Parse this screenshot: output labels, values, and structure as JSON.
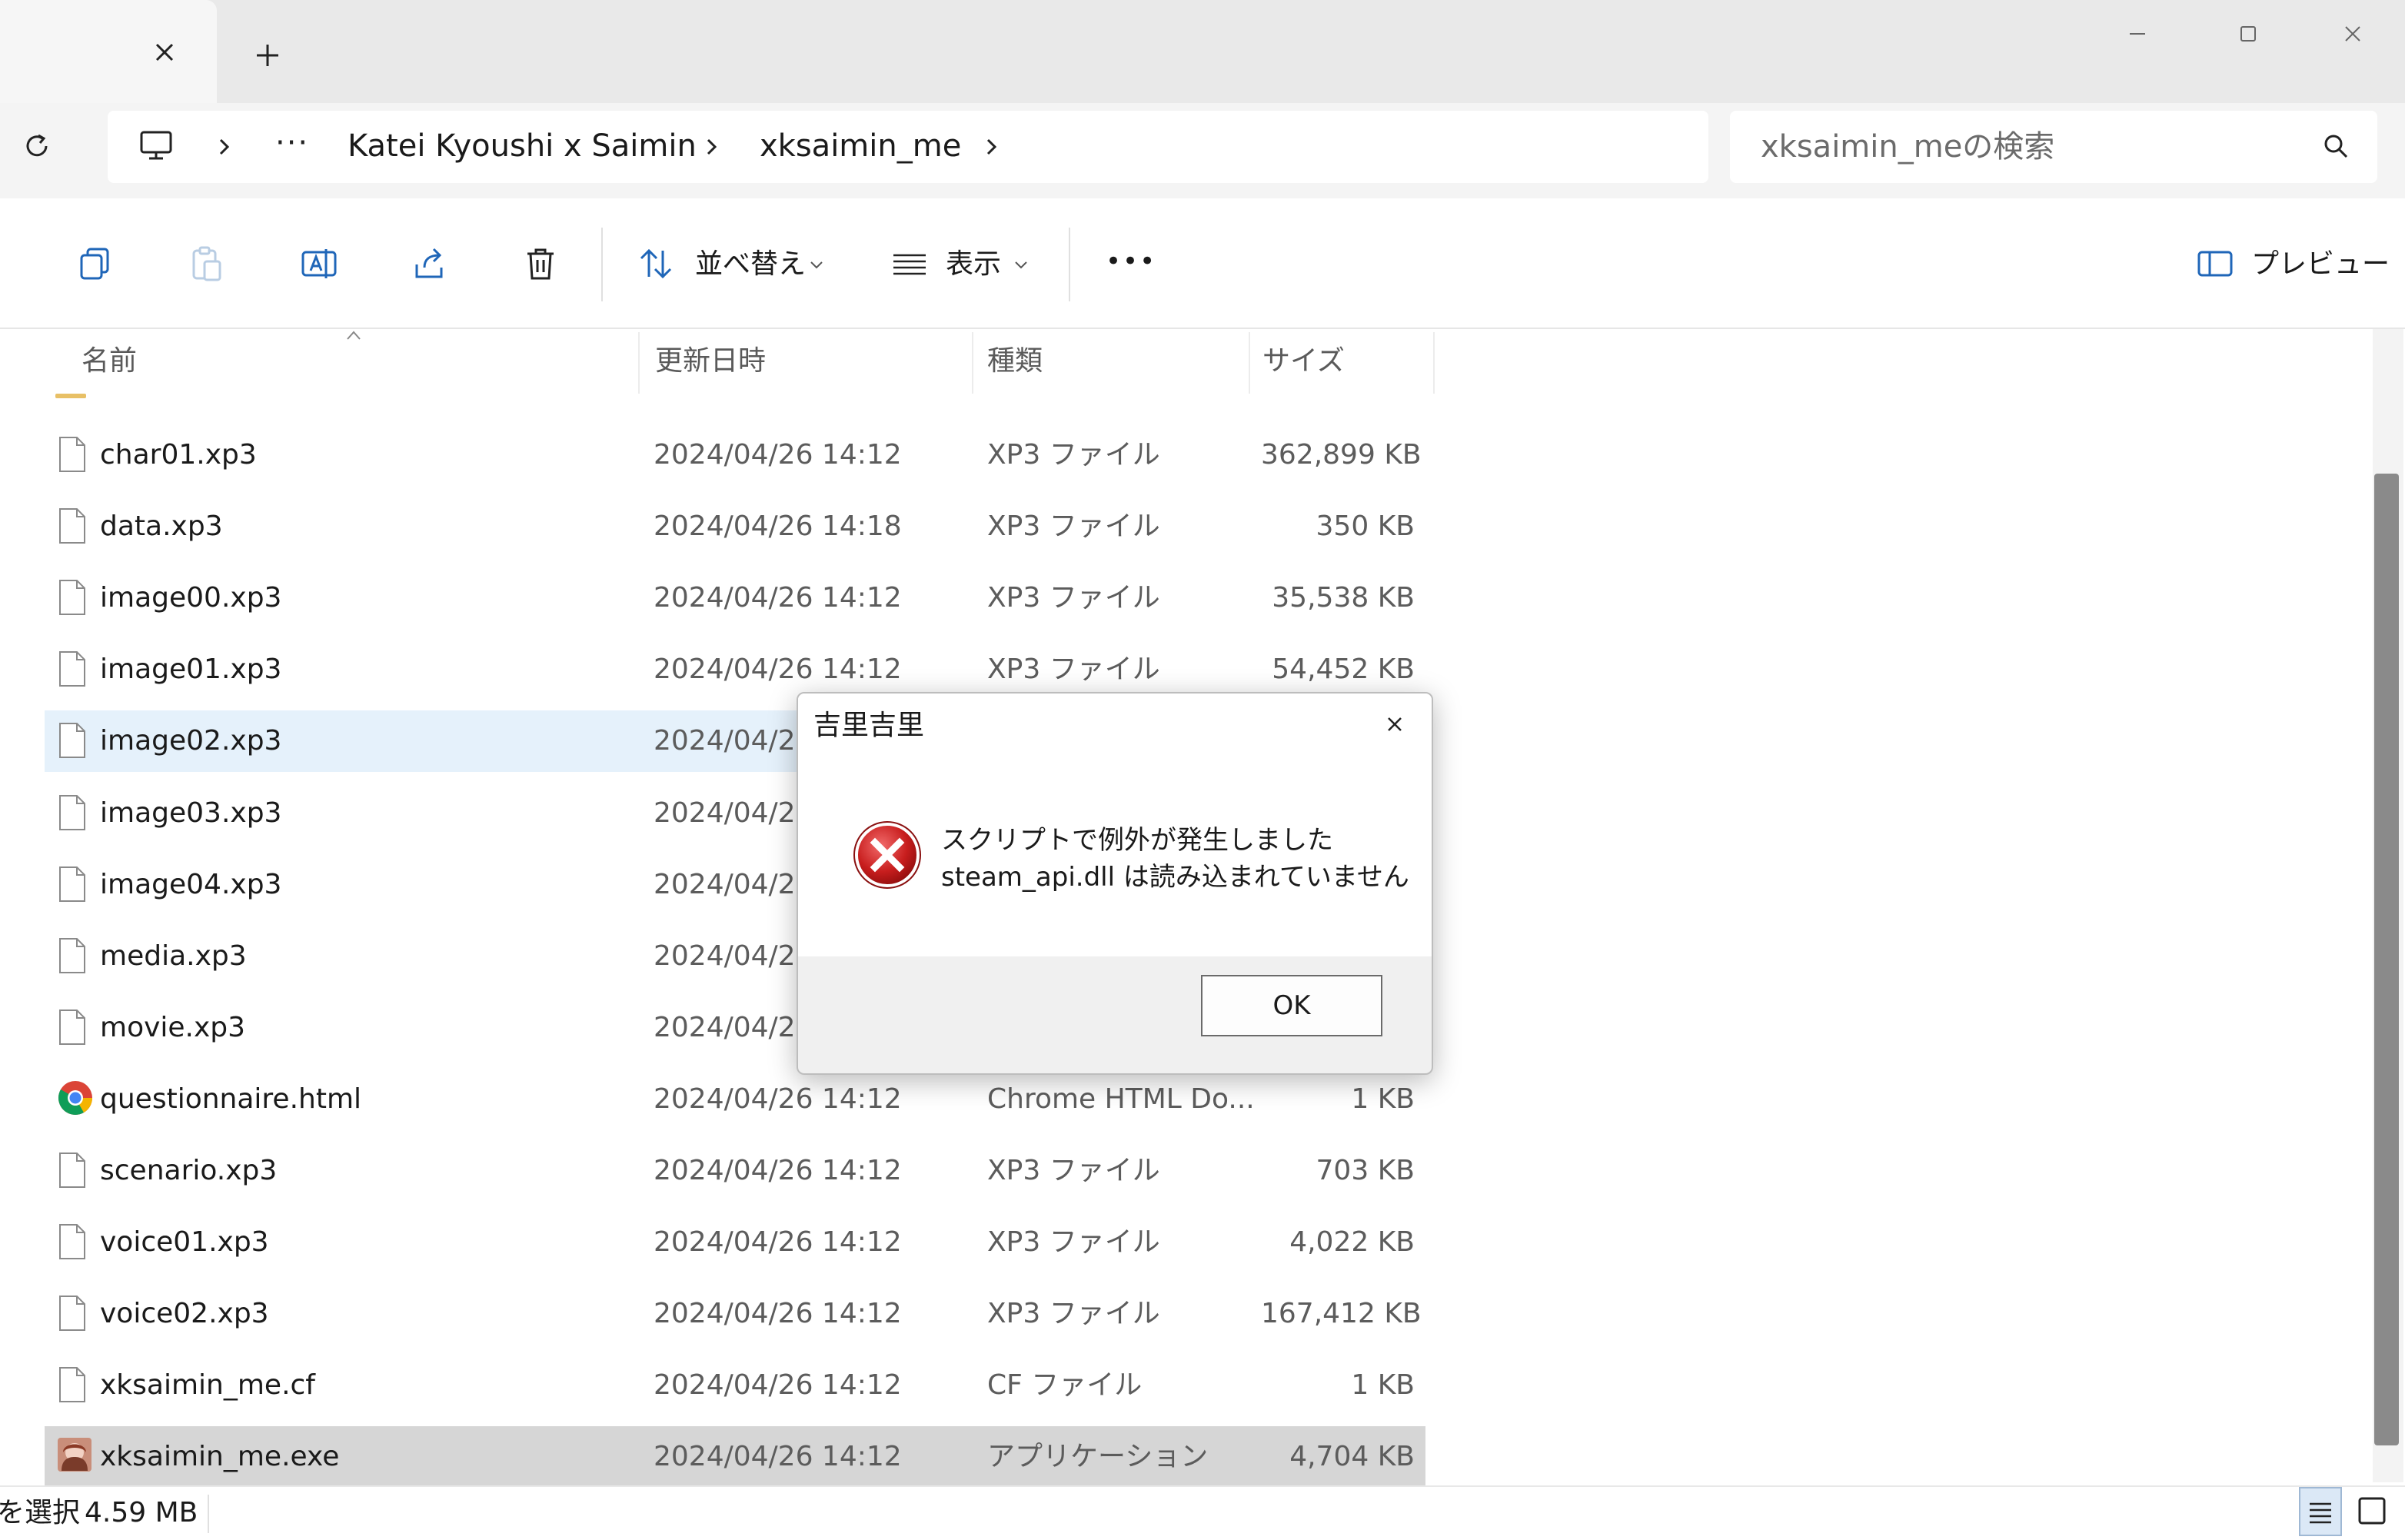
{
  "tabs": {
    "close_icon": "close-icon",
    "new_tab_icon": "plus-icon"
  },
  "window": {
    "minimize_icon": "minimize-icon",
    "maximize_icon": "maximize-icon",
    "close_icon": "close-icon"
  },
  "address": {
    "breadcrumbs": [
      "Katei Kyoushi x Saimin",
      "xksaimin_me"
    ],
    "ellipsis": "···"
  },
  "search": {
    "placeholder": "xksaimin_meの検索"
  },
  "toolbar": {
    "sort_label": "並べ替え",
    "view_label": "表示",
    "more_label": "•••",
    "preview_label": "プレビュー"
  },
  "columns": {
    "name": "名前",
    "modified": "更新日時",
    "type": "種類",
    "size": "サイズ"
  },
  "files": [
    {
      "name": "char01.xp3",
      "date": "2024/04/26 14:12",
      "type": "XP3 ファイル",
      "size": "362,899 KB",
      "icon": "file-icon"
    },
    {
      "name": "data.xp3",
      "date": "2024/04/26 14:18",
      "type": "XP3 ファイル",
      "size": "350 KB",
      "icon": "file-icon"
    },
    {
      "name": "image00.xp3",
      "date": "2024/04/26 14:12",
      "type": "XP3 ファイル",
      "size": "35,538 KB",
      "icon": "file-icon"
    },
    {
      "name": "image01.xp3",
      "date": "2024/04/26 14:12",
      "type": "XP3 ファイル",
      "size": "54,452 KB",
      "icon": "file-icon"
    },
    {
      "name": "image02.xp3",
      "date": "2024/04/26",
      "type": "",
      "size": "",
      "icon": "file-icon"
    },
    {
      "name": "image03.xp3",
      "date": "2024/04/26",
      "type": "",
      "size": "",
      "icon": "file-icon"
    },
    {
      "name": "image04.xp3",
      "date": "2024/04/26",
      "type": "",
      "size": "",
      "icon": "file-icon"
    },
    {
      "name": "media.xp3",
      "date": "2024/04/26",
      "type": "",
      "size": "",
      "icon": "file-icon"
    },
    {
      "name": "movie.xp3",
      "date": "2024/04/26",
      "type": "",
      "size": "",
      "icon": "file-icon"
    },
    {
      "name": "questionnaire.html",
      "date": "2024/04/26 14:12",
      "type": "Chrome HTML Do...",
      "size": "1 KB",
      "icon": "chrome-icon"
    },
    {
      "name": "scenario.xp3",
      "date": "2024/04/26 14:12",
      "type": "XP3 ファイル",
      "size": "703 KB",
      "icon": "file-icon"
    },
    {
      "name": "voice01.xp3",
      "date": "2024/04/26 14:12",
      "type": "XP3 ファイル",
      "size": "4,022 KB",
      "icon": "file-icon"
    },
    {
      "name": "voice02.xp3",
      "date": "2024/04/26 14:12",
      "type": "XP3 ファイル",
      "size": "167,412 KB",
      "icon": "file-icon"
    },
    {
      "name": "xksaimin_me.cf",
      "date": "2024/04/26 14:12",
      "type": "CF ファイル",
      "size": "1 KB",
      "icon": "file-icon"
    },
    {
      "name": "xksaimin_me.exe",
      "date": "2024/04/26 14:12",
      "type": "アプリケーション",
      "size": "4,704 KB",
      "icon": "app-icon"
    }
  ],
  "status": {
    "selected_label": "を選択",
    "selected_size": "4.59 MB"
  },
  "dialog": {
    "title": "吉里吉里",
    "message_line1": "スクリプトで例外が発生しました",
    "message_line2": "steam_api.dll は読み込まれていません",
    "ok_label": "OK",
    "icon": "error-icon"
  }
}
